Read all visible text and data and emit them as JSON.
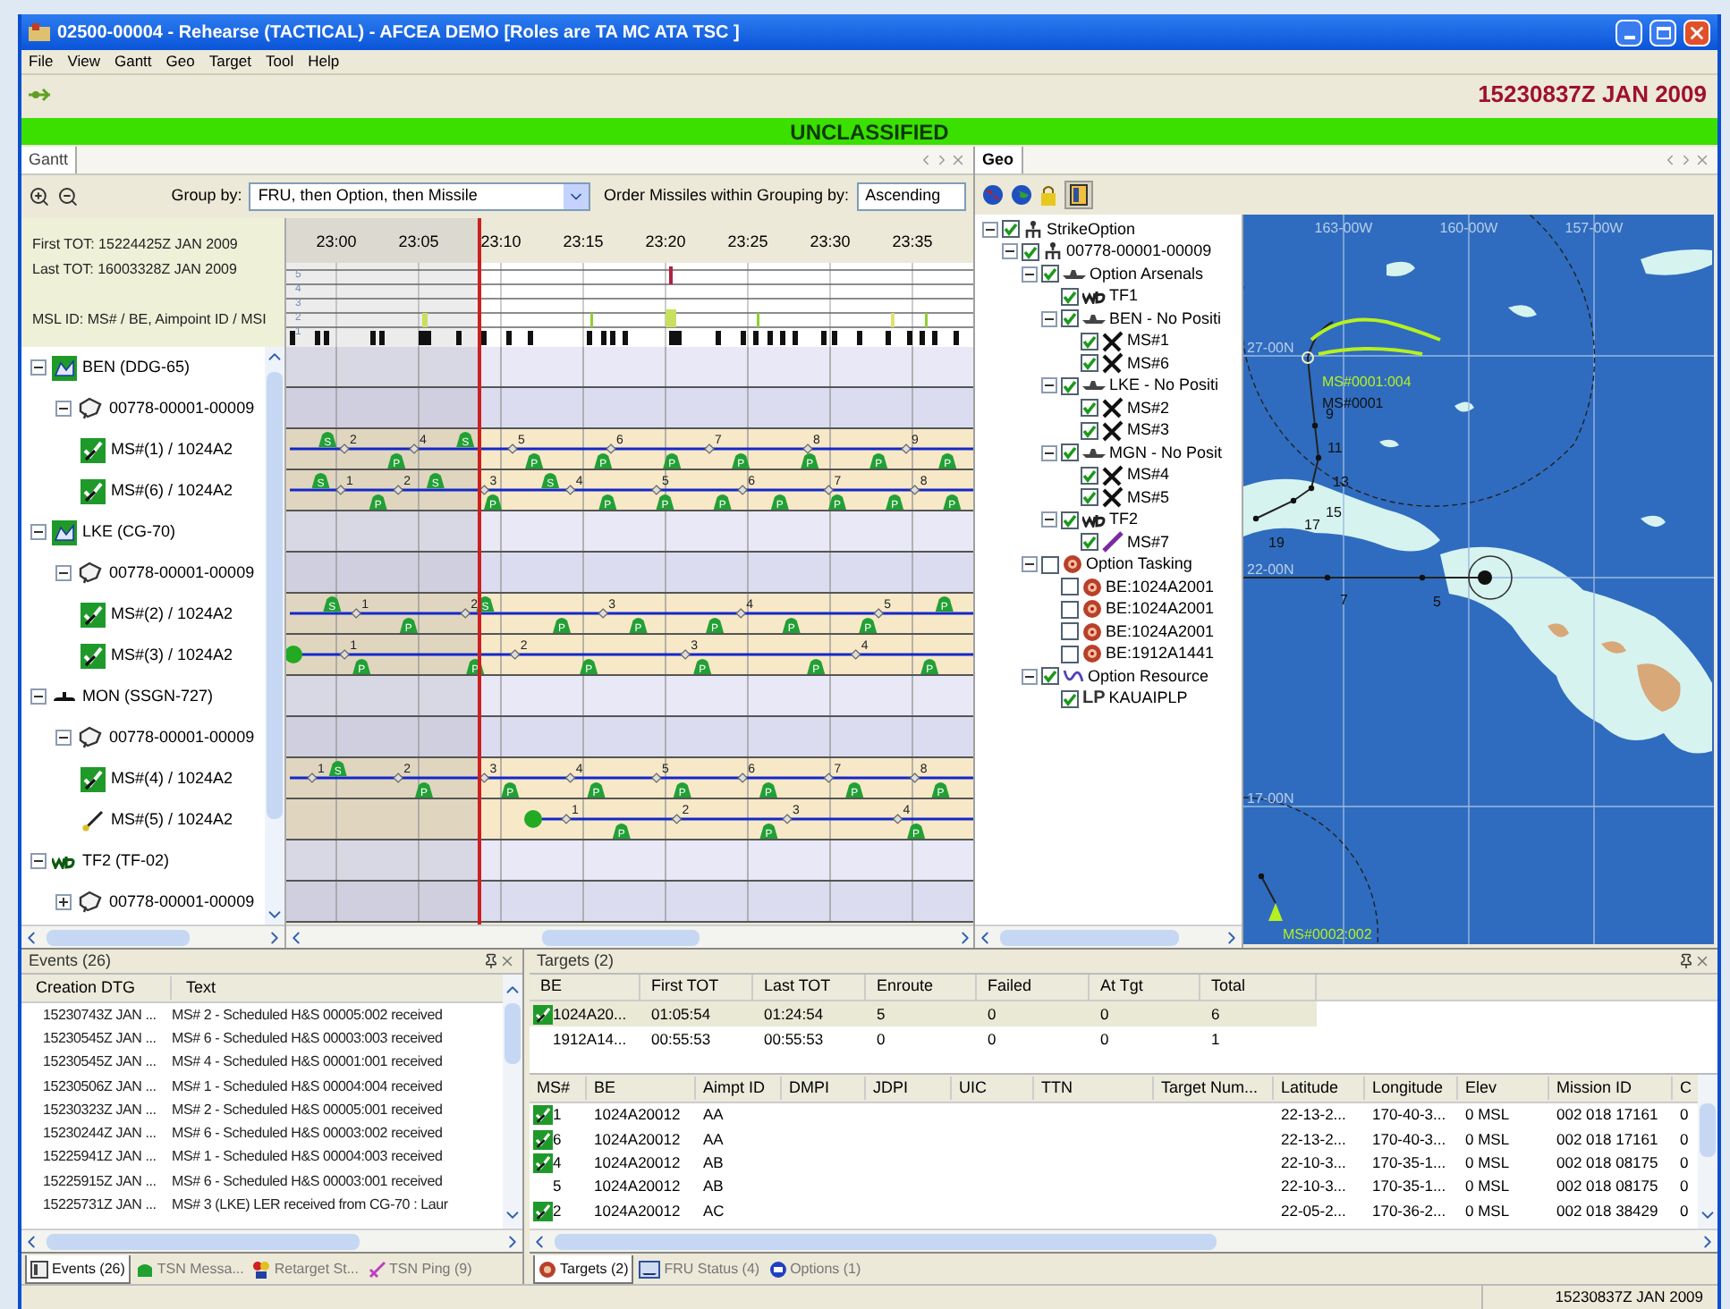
{
  "window": {
    "title": "02500-00004 - Rehearse (TACTICAL) - AFCEA DEMO [Roles are TA MC ATA TSC ]"
  },
  "menu": [
    "File",
    "View",
    "Gantt",
    "Geo",
    "Target",
    "Tool",
    "Help"
  ],
  "toolbar": {
    "datetime": "15230837Z JAN 2009"
  },
  "classification": "UNCLASSIFIED",
  "gantt": {
    "tab": "Gantt",
    "group_by_label": "Group by:",
    "group_by": "FRU, then Option, then Missile",
    "order_label": "Order Missiles within Grouping by:",
    "order": "Ascending",
    "first_tot": "First TOT: 15224425Z JAN 2009",
    "last_tot": "Last TOT: 16003328Z JAN 2009",
    "msl_id": "MSL ID: MS# / BE, Aimpoint ID / MSI",
    "time_labels": [
      "23:00",
      "23:05",
      "23:10",
      "23:15",
      "23:20",
      "23:25",
      "23:30",
      "23:35"
    ],
    "histogram_scale": [
      "5",
      "4",
      "3",
      "2",
      "1"
    ],
    "tree": [
      {
        "label": "BEN (DDG-65)",
        "kind": "ship",
        "expanded": true,
        "children": [
          {
            "label": "00778-00001-00009",
            "kind": "option",
            "expanded": true,
            "children": [
              {
                "label": "MS#(1) / 1024A2",
                "kind": "missile",
                "checked": true,
                "waypoints": [
                  "2",
                  "4",
                  "5",
                  "6",
                  "7",
                  "8",
                  "9"
                ],
                "pods": [
                  "S",
                  "P",
                  "S",
                  "P",
                  "P",
                  "P",
                  "P",
                  "P",
                  "P",
                  "P"
                ]
              },
              {
                "label": "MS#(6) / 1024A2",
                "kind": "missile",
                "checked": true,
                "waypoints": [
                  "1",
                  "2",
                  "3",
                  "4",
                  "5",
                  "6",
                  "7",
                  "8"
                ],
                "pods": [
                  "S",
                  "P",
                  "S",
                  "P",
                  "S",
                  "P",
                  "P",
                  "P",
                  "P",
                  "P",
                  "P",
                  "P"
                ]
              }
            ]
          }
        ]
      },
      {
        "label": "LKE (CG-70)",
        "kind": "ship",
        "expanded": true,
        "children": [
          {
            "label": "00778-00001-00009",
            "kind": "option",
            "expanded": true,
            "children": [
              {
                "label": "MS#(2) / 1024A2",
                "kind": "missile",
                "checked": true,
                "waypoints": [
                  "1",
                  "2",
                  "3",
                  "4",
                  "5"
                ],
                "pods": [
                  "S",
                  "P",
                  "S",
                  "P",
                  "P",
                  "P",
                  "P",
                  "P",
                  "P"
                ]
              },
              {
                "label": "MS#(3) / 1024A2",
                "kind": "missile",
                "checked": true,
                "waypoints": [
                  "1",
                  "2",
                  "3",
                  "4"
                ],
                "pods": [
                  "P",
                  "P",
                  "P",
                  "P",
                  "P",
                  "P"
                ]
              }
            ]
          }
        ]
      },
      {
        "label": "MON (SSGN-727)",
        "kind": "submarine",
        "expanded": true,
        "children": [
          {
            "label": "00778-00001-00009",
            "kind": "option",
            "expanded": true,
            "children": [
              {
                "label": "MS#(4) / 1024A2",
                "kind": "missile",
                "checked": true,
                "waypoints": [
                  "1",
                  "2",
                  "3",
                  "4",
                  "5",
                  "6",
                  "7",
                  "8"
                ],
                "pods": [
                  "S",
                  "P",
                  "P",
                  "P",
                  "P",
                  "P",
                  "P",
                  "P"
                ]
              },
              {
                "label": "MS#(5) / 1024A2",
                "kind": "missile",
                "checked": false,
                "waypoints": [
                  "1",
                  "2",
                  "3",
                  "4"
                ],
                "pods": [
                  "P",
                  "P",
                  "P"
                ]
              }
            ]
          }
        ]
      },
      {
        "label": "TF2 (TF-02)",
        "kind": "taskforce",
        "expanded": true,
        "children": [
          {
            "label": "00778-00001-00009",
            "kind": "option",
            "expanded": false
          }
        ]
      }
    ]
  },
  "geo": {
    "tab": "Geo",
    "tree": [
      {
        "label": "StrikeOption",
        "kind": "strike",
        "checked": true,
        "expanded": true,
        "children": [
          {
            "label": "00778-00001-00009",
            "kind": "strike",
            "checked": true,
            "expanded": true,
            "children": [
              {
                "label": "Option Arsenals",
                "kind": "ship",
                "checked": true,
                "expanded": true,
                "children": [
                  {
                    "label": "TF1",
                    "kind": "taskforce",
                    "checked": true
                  },
                  {
                    "label": "BEN - No Positi",
                    "kind": "ship",
                    "checked": true,
                    "expanded": true,
                    "children": [
                      {
                        "label": "MS#1",
                        "kind": "missile",
                        "checked": true
                      },
                      {
                        "label": "MS#6",
                        "kind": "missile",
                        "checked": true
                      }
                    ]
                  },
                  {
                    "label": "LKE - No Positi",
                    "kind": "ship",
                    "checked": true,
                    "expanded": true,
                    "children": [
                      {
                        "label": "MS#2",
                        "kind": "missile",
                        "checked": true
                      },
                      {
                        "label": "MS#3",
                        "kind": "missile",
                        "checked": true
                      }
                    ]
                  },
                  {
                    "label": "MGN - No Posit",
                    "kind": "ship",
                    "checked": true,
                    "expanded": true,
                    "children": [
                      {
                        "label": "MS#4",
                        "kind": "missile",
                        "checked": true
                      },
                      {
                        "label": "MS#5",
                        "kind": "missile",
                        "checked": true
                      }
                    ]
                  },
                  {
                    "label": "TF2",
                    "kind": "taskforce",
                    "checked": true,
                    "expanded": true,
                    "children": [
                      {
                        "label": "MS#7",
                        "kind": "single_missile",
                        "checked": true
                      }
                    ]
                  }
                ]
              },
              {
                "label": "Option Tasking",
                "kind": "target",
                "checked": false,
                "expanded": true,
                "children": [
                  {
                    "label": "BE:1024A2001",
                    "kind": "target",
                    "checked": false
                  },
                  {
                    "label": "BE:1024A2001",
                    "kind": "target",
                    "checked": false
                  },
                  {
                    "label": "BE:1024A2001",
                    "kind": "target",
                    "checked": false
                  },
                  {
                    "label": "BE:1912A1441",
                    "kind": "target",
                    "checked": false
                  }
                ]
              },
              {
                "label": "Option Resource",
                "kind": "resource",
                "checked": true,
                "expanded": true,
                "children": [
                  {
                    "label": "KAUAIPLP",
                    "kind": "launch",
                    "badge": "LP",
                    "checked": true
                  }
                ]
              }
            ]
          }
        ]
      }
    ],
    "grid_labels": [
      "163-00W",
      "160-00W",
      "157-00W",
      "27-00N",
      "22-00N",
      "17-00N"
    ],
    "track_labels": [
      "MS#0001:004",
      "MS#0001",
      "9",
      "11",
      "13",
      "15",
      "17",
      "19",
      "7",
      "5",
      "MS#0002:002"
    ]
  },
  "events": {
    "title": "Events (26)",
    "columns": [
      "Creation DTG",
      "Text"
    ],
    "rows": [
      {
        "dtg": "15230743Z JAN ...",
        "text": "MS# 2 - Scheduled H&S 00005:002 received"
      },
      {
        "dtg": "15230545Z JAN ...",
        "text": "MS# 6 - Scheduled H&S 00003:003 received"
      },
      {
        "dtg": "15230545Z JAN ...",
        "text": "MS# 4 - Scheduled H&S 00001:001 received"
      },
      {
        "dtg": "15230506Z JAN ...",
        "text": "MS# 1 - Scheduled H&S 00004:004 received"
      },
      {
        "dtg": "15230323Z JAN ...",
        "text": "MS# 2 - Scheduled H&S 00005:001 received"
      },
      {
        "dtg": "15230244Z JAN ...",
        "text": "MS# 6 - Scheduled H&S 00003:002 received"
      },
      {
        "dtg": "15225941Z JAN ...",
        "text": "MS# 1 - Scheduled H&S 00004:003 received"
      },
      {
        "dtg": "15225915Z JAN ...",
        "text": "MS# 6 - Scheduled H&S 00003:001 received"
      },
      {
        "dtg": "15225731Z JAN ...",
        "text": "MS# 3 (LKE) LER received from CG-70 : Laur"
      }
    ],
    "tabs": [
      {
        "label": "Events (26)",
        "kind": "events",
        "selected": true
      },
      {
        "label": "TSN Messa...",
        "kind": "message",
        "selected": false
      },
      {
        "label": "Retarget St...",
        "kind": "retarget",
        "selected": false
      },
      {
        "label": "TSN Ping (9)",
        "kind": "ping",
        "selected": false
      }
    ]
  },
  "targets": {
    "title": "Targets (2)",
    "summary_columns": [
      "BE",
      "First TOT",
      "Last TOT",
      "Enroute",
      "Failed",
      "At Tgt",
      "Total"
    ],
    "summary_rows": [
      {
        "checked": true,
        "selected": true,
        "cells": [
          "1024A20...",
          "01:05:54",
          "01:24:54",
          "5",
          "0",
          "0",
          "6"
        ]
      },
      {
        "checked": false,
        "selected": false,
        "cells": [
          "1912A14...",
          "00:55:53",
          "00:55:53",
          "0",
          "0",
          "0",
          "1"
        ]
      }
    ],
    "missile_columns": [
      "MS#",
      "BE",
      "Aimpt ID",
      "DMPI",
      "JDPI",
      "UIC",
      "TTN",
      "Target Num...",
      "Latitude",
      "Longitude",
      "Elev",
      "Mission ID",
      "C"
    ],
    "missile_rows": [
      {
        "checked": true,
        "cells": [
          "1",
          "1024A20012",
          "AA",
          "",
          "",
          "",
          "",
          "",
          "22-13-2...",
          "170-40-3...",
          "0 MSL",
          "002 018 17161",
          "0"
        ]
      },
      {
        "checked": true,
        "cells": [
          "6",
          "1024A20012",
          "AA",
          "",
          "",
          "",
          "",
          "",
          "22-13-2...",
          "170-40-3...",
          "0 MSL",
          "002 018 17161",
          "0"
        ]
      },
      {
        "checked": true,
        "cells": [
          "4",
          "1024A20012",
          "AB",
          "",
          "",
          "",
          "",
          "",
          "22-10-3...",
          "170-35-1...",
          "0 MSL",
          "002 018 08175",
          "0"
        ]
      },
      {
        "checked": false,
        "cells": [
          "5",
          "1024A20012",
          "AB",
          "",
          "",
          "",
          "",
          "",
          "22-10-3...",
          "170-35-1...",
          "0 MSL",
          "002 018 08175",
          "0"
        ]
      },
      {
        "checked": true,
        "cells": [
          "2",
          "1024A20012",
          "AC",
          "",
          "",
          "",
          "",
          "",
          "22-05-2...",
          "170-36-2...",
          "0 MSL",
          "002 018 38429",
          "0"
        ]
      }
    ],
    "tabs": [
      {
        "label": "Targets (2)",
        "kind": "targets",
        "selected": true
      },
      {
        "label": "FRU Status (4)",
        "kind": "fru",
        "selected": false
      },
      {
        "label": "Options (1)",
        "kind": "options",
        "selected": false
      }
    ]
  },
  "status_bar": {
    "datetime": "15230837Z JAN 2009"
  }
}
